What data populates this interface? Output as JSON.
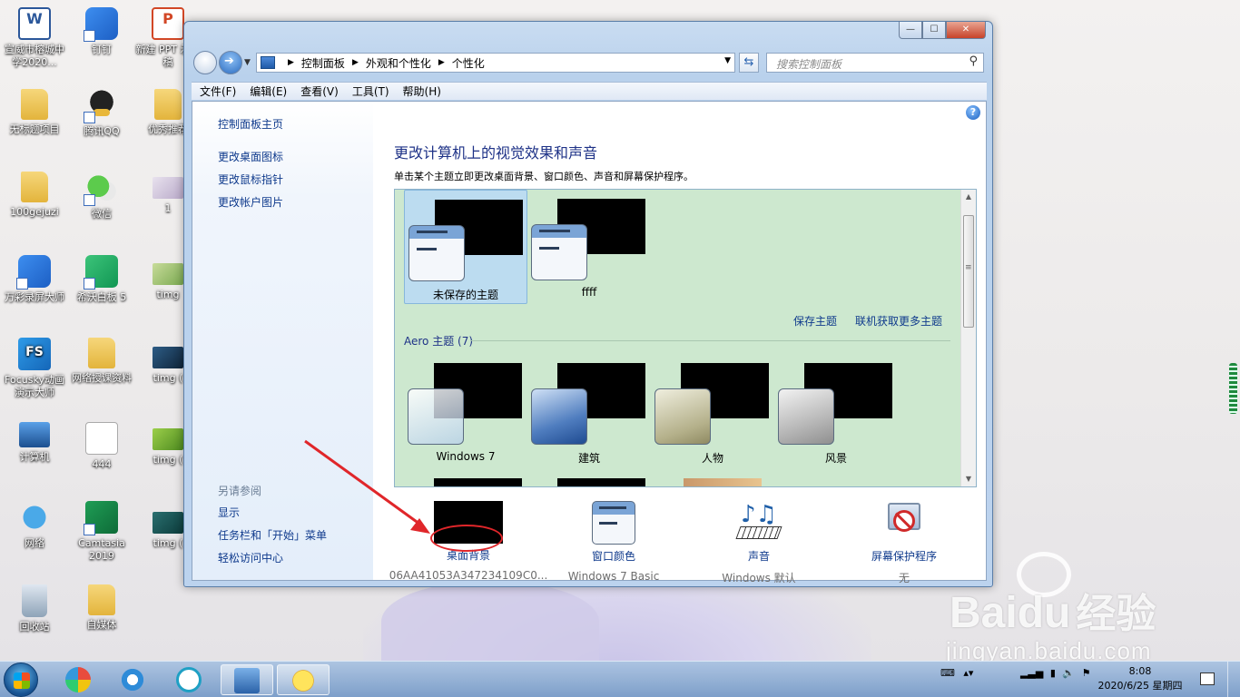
{
  "desktop": {
    "icons": [
      {
        "label": "宣威市榕城中学2020...",
        "icon": "word-doc-icon"
      },
      {
        "label": "钉钉",
        "icon": "dingtalk-icon"
      },
      {
        "label": "新建 PPT 示文稿",
        "icon": "ppt-doc-icon"
      },
      {
        "label": "无标题项目",
        "icon": "folder-icon"
      },
      {
        "label": "腾讯QQ",
        "icon": "qq-icon"
      },
      {
        "label": "优秀推荐",
        "icon": "folder-icon"
      },
      {
        "label": "100gejuzi",
        "icon": "folder-icon"
      },
      {
        "label": "微信",
        "icon": "wechat-icon"
      },
      {
        "label": "1",
        "icon": "image-file-icon"
      },
      {
        "label": "万彩录屏大师",
        "icon": "recorder-icon"
      },
      {
        "label": "希沃白板 5",
        "icon": "seewo-icon"
      },
      {
        "label": "timg",
        "icon": "image-file-icon"
      },
      {
        "label": "Focusky动画演示大师",
        "icon": "focusky-icon"
      },
      {
        "label": "网络授课资料",
        "icon": "folder-icon"
      },
      {
        "label": "timg (",
        "icon": "image-file-icon"
      },
      {
        "label": "计算机",
        "icon": "computer-icon"
      },
      {
        "label": "444",
        "icon": "fs-file-icon"
      },
      {
        "label": "timg (",
        "icon": "image-file-icon"
      },
      {
        "label": "网络",
        "icon": "network-icon"
      },
      {
        "label": "Camtasia 2019",
        "icon": "camtasia-icon"
      },
      {
        "label": "timg (",
        "icon": "image-file-icon"
      },
      {
        "label": "回收站",
        "icon": "recycle-bin-icon"
      },
      {
        "label": "自媒体",
        "icon": "folder-icon"
      }
    ]
  },
  "window": {
    "controls": {
      "minimize": "—",
      "maximize": "☐",
      "close": "✕"
    },
    "address": {
      "crumbs": [
        "控制面板",
        "外观和个性化",
        "个性化"
      ]
    },
    "search": {
      "placeholder": "搜索控制面板"
    },
    "menu": [
      "文件(F)",
      "编辑(E)",
      "查看(V)",
      "工具(T)",
      "帮助(H)"
    ],
    "left_pane": {
      "home": "控制面板主页",
      "links": [
        "更改桌面图标",
        "更改鼠标指针",
        "更改帐户图片"
      ],
      "see_also_heading": "另请参阅",
      "see_also": [
        "显示",
        "任务栏和「开始」菜单",
        "轻松访问中心"
      ]
    },
    "main": {
      "title": "更改计算机上的视觉效果和声音",
      "description": "单击某个主题立即更改桌面背景、窗口颜色、声音和屏幕保护程序。",
      "my_themes": [
        {
          "label": "未保存的主题",
          "selected": true
        },
        {
          "label": "ffff",
          "selected": false
        }
      ],
      "save_theme": "保存主题",
      "get_more": "联机获取更多主题",
      "aero_heading": "Aero 主题 (7)",
      "aero_themes": [
        {
          "label": "Windows 7",
          "style": "glass"
        },
        {
          "label": "建筑",
          "style": "arch"
        },
        {
          "label": "人物",
          "style": "people"
        },
        {
          "label": "风景",
          "style": "land"
        }
      ],
      "settings": [
        {
          "name": "desktop-background",
          "label": "桌面背景",
          "value": "06AA41053A347234109C0..."
        },
        {
          "name": "window-color",
          "label": "窗口颜色",
          "value": "Windows 7 Basic"
        },
        {
          "name": "sound",
          "label": "声音",
          "value": "Windows 默认"
        },
        {
          "name": "screen-saver",
          "label": "屏幕保护程序",
          "value": "无"
        }
      ]
    }
  },
  "watermark": {
    "logo": "Baidu",
    "logo_suffix": "经验",
    "url": "jingyan.baidu.com"
  },
  "taskbar": {
    "clock_time": "8:08",
    "clock_date": "2020/6/25 星期四"
  },
  "colors": {
    "link": "#0f3a8c",
    "title": "#1e3287",
    "annotation": "#e0262a",
    "theme_area": "#cde8cf"
  }
}
